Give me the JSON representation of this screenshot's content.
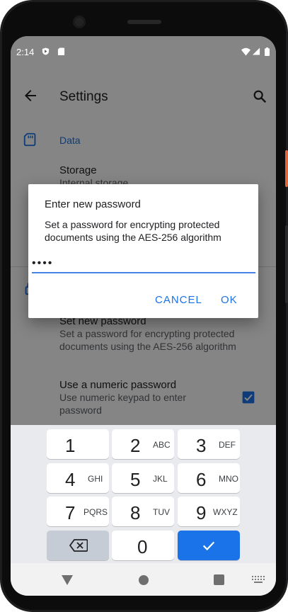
{
  "statusbar": {
    "time": "2:14"
  },
  "appbar": {
    "title": "Settings"
  },
  "background": {
    "data_category": "Data",
    "storage_title": "Storage",
    "storage_subtitle": "Internal storage",
    "set_password_title": "Set new password",
    "set_password_subtitle": "Set a password for encrypting protected documents using the AES-256 algorithm",
    "numeric_title": "Use a numeric password",
    "numeric_subtitle": "Use numeric keypad to enter password",
    "numeric_checked": true
  },
  "dialog": {
    "title": "Enter new password",
    "message": "Set a password for encrypting protected documents using the AES-256 algorithm",
    "input_value": "••••",
    "cancel_label": "CANCEL",
    "ok_label": "OK"
  },
  "keyboard": {
    "keys": [
      {
        "num": "1",
        "letters": ""
      },
      {
        "num": "2",
        "letters": "ABC"
      },
      {
        "num": "3",
        "letters": "DEF"
      },
      {
        "num": "4",
        "letters": "GHI"
      },
      {
        "num": "5",
        "letters": "JKL"
      },
      {
        "num": "6",
        "letters": "MNO"
      },
      {
        "num": "7",
        "letters": "PQRS"
      },
      {
        "num": "8",
        "letters": "TUV"
      },
      {
        "num": "9",
        "letters": "WXYZ"
      }
    ],
    "zero": "0",
    "accent_color": "#1a73e8"
  },
  "icons": {
    "back": "arrow-back-icon",
    "search": "search-icon",
    "sd_card": "sd-card-icon",
    "lock": "lock-icon",
    "backspace": "backspace-icon",
    "done": "check-icon"
  }
}
